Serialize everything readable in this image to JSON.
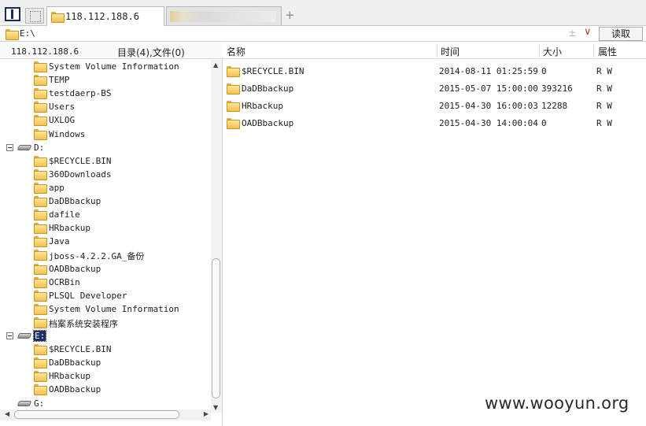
{
  "tabs": {
    "active_label": "118.112.188.6",
    "plus": "+"
  },
  "address": {
    "path": "E:\\",
    "clear_glyph": "±",
    "dropdown_glyph": "∨",
    "read_button": "读取"
  },
  "left_panel": {
    "host": "118.112.188.6",
    "summary": "目录(4),文件(0)",
    "tree": [
      {
        "kind": "folder",
        "label": "System Volume Information"
      },
      {
        "kind": "folder",
        "label": "TEMP"
      },
      {
        "kind": "folder",
        "label": "testdaerp-BS"
      },
      {
        "kind": "folder",
        "label": "Users"
      },
      {
        "kind": "folder",
        "label": "UXLOG"
      },
      {
        "kind": "folder",
        "label": "Windows"
      },
      {
        "kind": "drive",
        "label": "D:"
      },
      {
        "kind": "folder",
        "label": "$RECYCLE.BIN"
      },
      {
        "kind": "folder",
        "label": "360Downloads"
      },
      {
        "kind": "folder",
        "label": "app"
      },
      {
        "kind": "folder",
        "label": "DaDBbackup"
      },
      {
        "kind": "folder",
        "label": "dafile"
      },
      {
        "kind": "folder",
        "label": "HRbackup"
      },
      {
        "kind": "folder",
        "label": "Java"
      },
      {
        "kind": "folder",
        "label": "jboss-4.2.2.GA_备份"
      },
      {
        "kind": "folder",
        "label": "OADBbackup"
      },
      {
        "kind": "folder",
        "label": "OCRBin"
      },
      {
        "kind": "folder",
        "label": "PLSQL Developer"
      },
      {
        "kind": "folder",
        "label": "System Volume Information"
      },
      {
        "kind": "folder",
        "label": "档案系统安装程序"
      },
      {
        "kind": "drive",
        "label": "E:",
        "selected": true
      },
      {
        "kind": "folder",
        "label": "$RECYCLE.BIN"
      },
      {
        "kind": "folder",
        "label": "DaDBbackup"
      },
      {
        "kind": "folder",
        "label": "HRbackup"
      },
      {
        "kind": "folder",
        "label": "OADBbackup"
      },
      {
        "kind": "drive",
        "label": "G:",
        "noexpander": true
      }
    ]
  },
  "file_list": {
    "columns": {
      "name": "名称",
      "time": "时间",
      "size": "大小",
      "attr": "属性"
    },
    "rows": [
      {
        "name": "$RECYCLE.BIN",
        "time": "2014-08-11 01:25:59",
        "size": "0",
        "attr": "R W"
      },
      {
        "name": "DaDBbackup",
        "time": "2015-05-07 15:00:00",
        "size": "393216",
        "attr": "R W"
      },
      {
        "name": "HRbackup",
        "time": "2015-04-30 16:00:03",
        "size": "12288",
        "attr": "R W"
      },
      {
        "name": "OADBbackup",
        "time": "2015-04-30 14:00:04",
        "size": "0",
        "attr": "R W"
      }
    ]
  },
  "watermark": "www.wooyun.org",
  "colors": {
    "selection": "#1c2f6b",
    "folder": "#f2c14e",
    "dropdown": "#c0392b"
  }
}
